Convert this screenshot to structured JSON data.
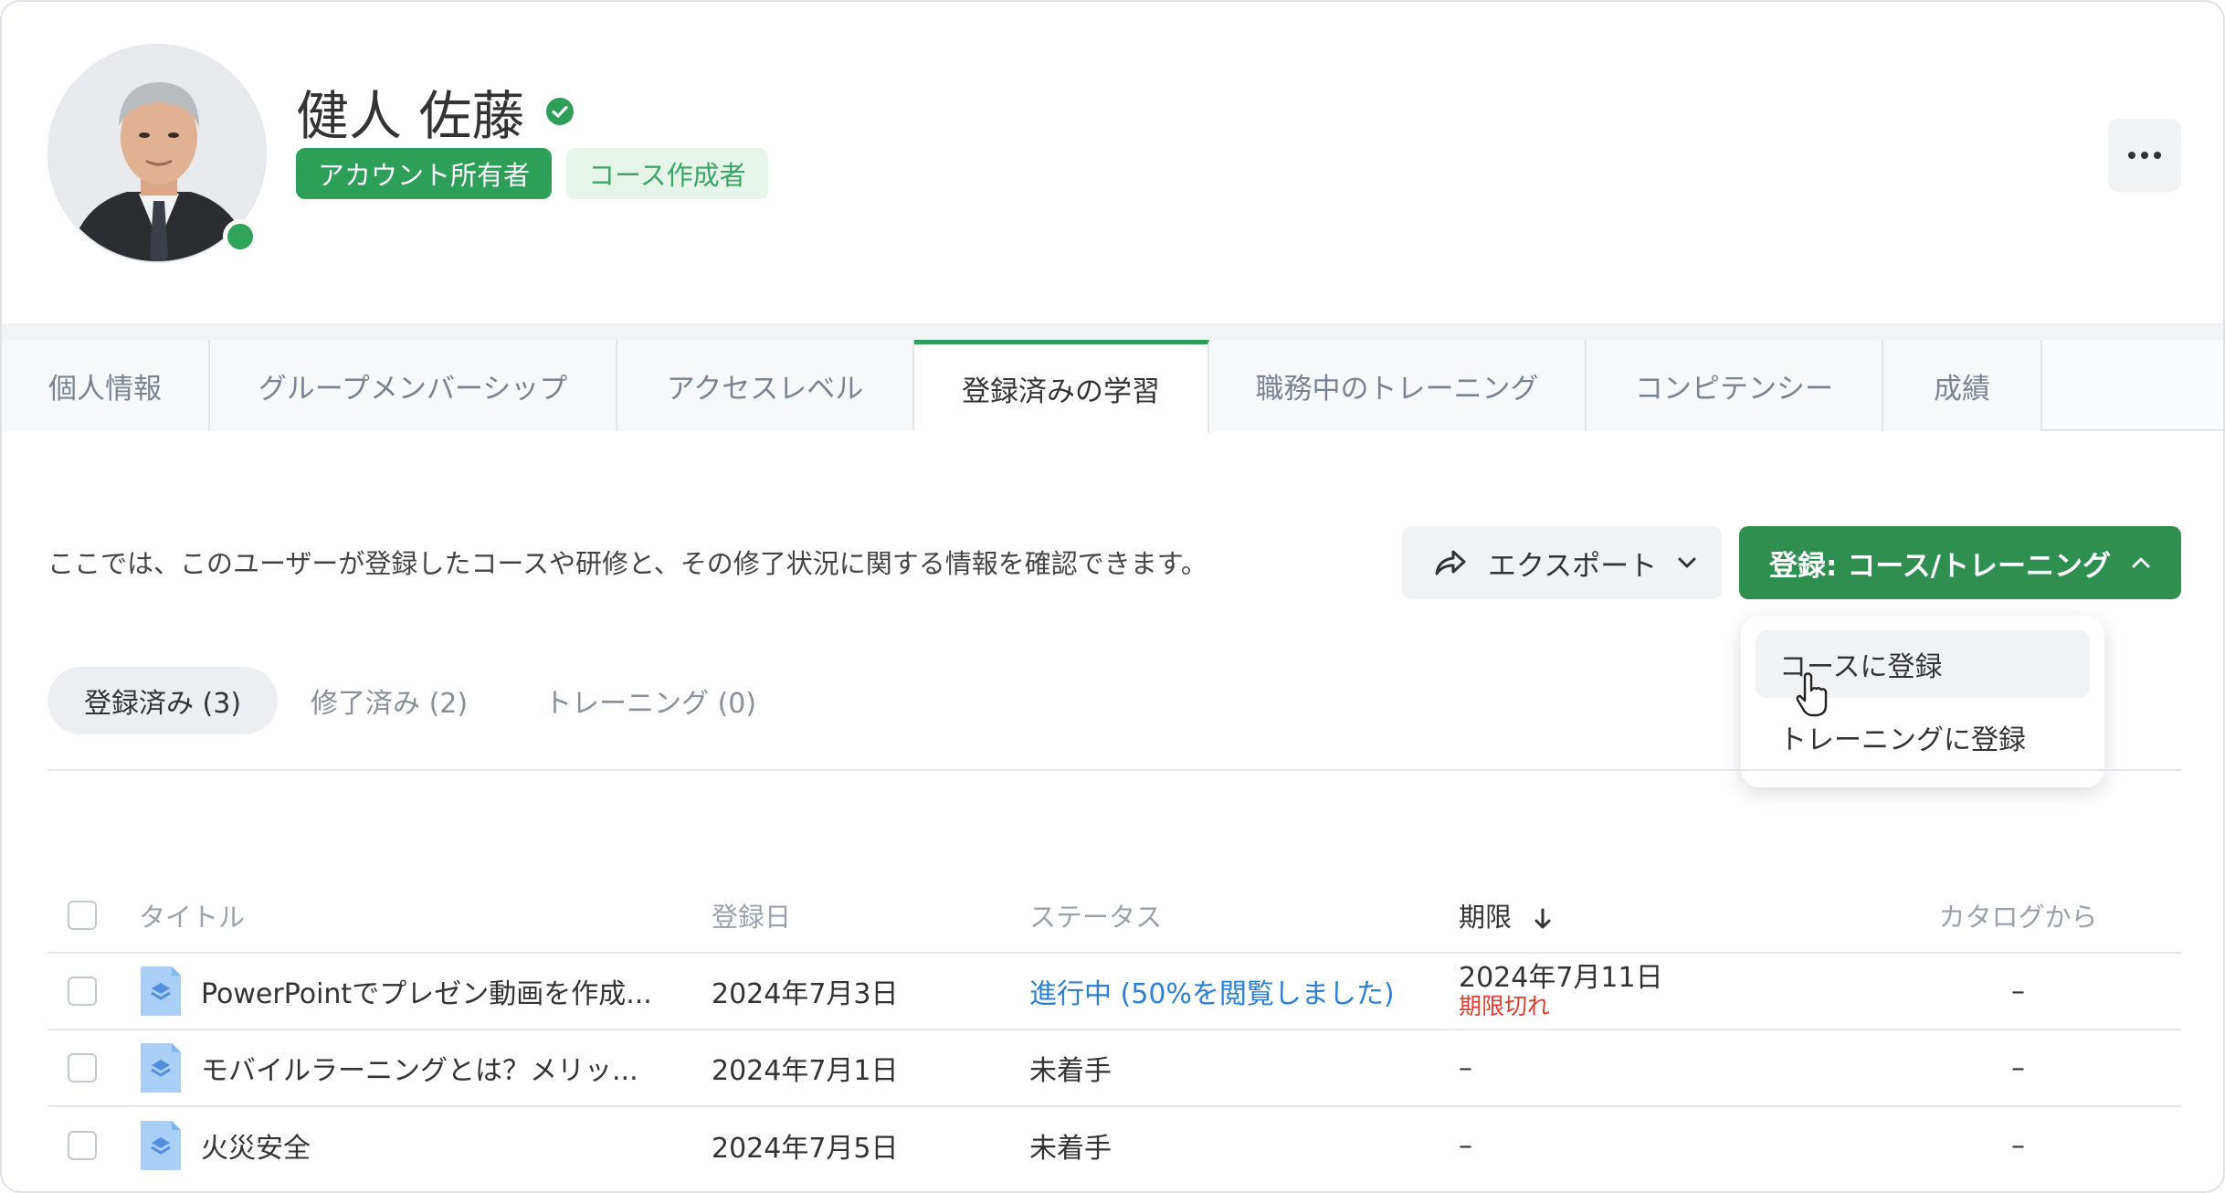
{
  "profile": {
    "name": "健人 佐藤",
    "badges": {
      "owner": "アカウント所有者",
      "creator": "コース作成者"
    },
    "more_label": "…"
  },
  "tabs": [
    {
      "label": "個人情報"
    },
    {
      "label": "グループメンバーシップ"
    },
    {
      "label": "アクセスレベル"
    },
    {
      "label": "登録済みの学習"
    },
    {
      "label": "職務中のトレーニング"
    },
    {
      "label": "コンピテンシー"
    },
    {
      "label": "成績"
    }
  ],
  "content": {
    "description": "ここでは、このユーザーが登録したコースや研修と、その修了状況に関する情報を確認できます。",
    "export_label": "エクスポート",
    "enroll_label": "登録: コース/トレーニング",
    "dropdown": {
      "course": "コースに登録",
      "training": "トレーニングに登録"
    },
    "filters": {
      "enrolled": "登録済み (3)",
      "completed": "修了済み (2)",
      "training": "トレーニング (0)"
    }
  },
  "table": {
    "headers": {
      "title": "タイトル",
      "date": "登録日",
      "status": "ステータス",
      "due": "期限",
      "catalog": "カタログから"
    },
    "rows": [
      {
        "title": "PowerPointでプレゼン動画を作成...",
        "date": "2024年7月3日",
        "status": "進行中 (50%を閲覧しました)",
        "due": "2024年7月11日",
        "due_note": "期限切れ",
        "catalog": "–"
      },
      {
        "title": "モバイルラーニングとは？メリッ...",
        "date": "2024年7月1日",
        "status": "未着手",
        "due": "–",
        "due_note": "",
        "catalog": "–"
      },
      {
        "title": "火災安全",
        "date": "2024年7月5日",
        "status": "未着手",
        "due": "–",
        "due_note": "",
        "catalog": "–"
      }
    ]
  },
  "colors": {
    "accent_green": "#2e9f58",
    "link_blue": "#2f7fd1",
    "expired_red": "#e03b2d"
  }
}
